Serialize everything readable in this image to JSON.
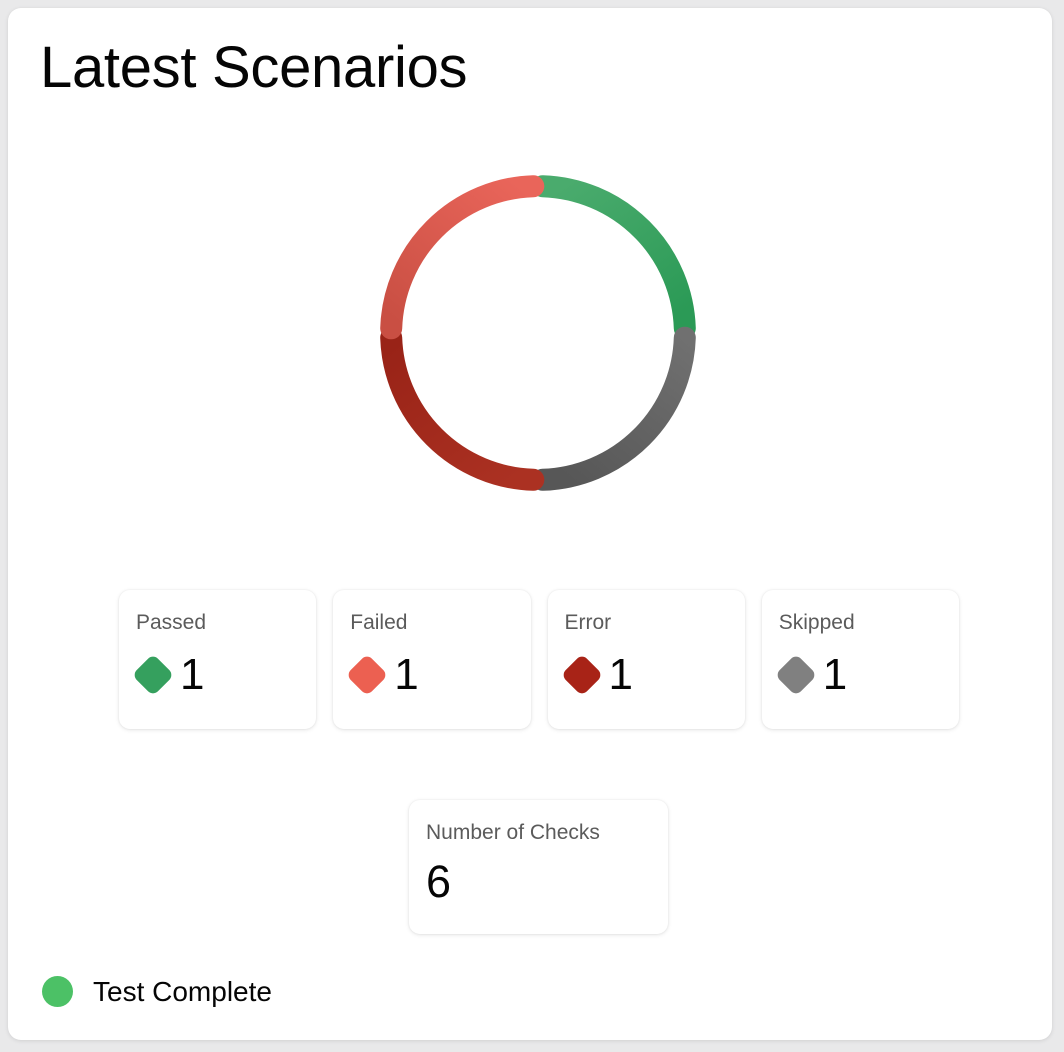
{
  "panel": {
    "title": "Latest Scenarios",
    "background_color": "#ffffff",
    "page_background_color": "#e9e9ea"
  },
  "chart_data": {
    "type": "pie",
    "variant": "donut",
    "title": "Latest Scenarios",
    "legend": "none",
    "grid": false,
    "total": 4,
    "gap_degrees": 6,
    "stroke_width_px": 22,
    "outer_radius_px": 158,
    "categories": [
      "Passed",
      "Failed",
      "Error",
      "Skipped"
    ],
    "values": [
      1,
      1,
      1,
      1
    ],
    "percentages": [
      25,
      25,
      25,
      25
    ],
    "colors": [
      "#35a05e",
      "#e05a4c",
      "#a22a1c",
      "#5e5e5e"
    ],
    "segments": [
      {
        "label": "Passed",
        "value": 1,
        "percent": 25,
        "color": "#35a05e",
        "start_deg": 0,
        "end_deg": 90,
        "position": "top-right"
      },
      {
        "label": "Skipped",
        "value": 1,
        "percent": 25,
        "color": "#5e5e5e",
        "start_deg": 90,
        "end_deg": 180,
        "position": "bottom-right"
      },
      {
        "label": "Error",
        "value": 1,
        "percent": 25,
        "color": "#a22a1c",
        "start_deg": 180,
        "end_deg": 270,
        "position": "bottom-left"
      },
      {
        "label": "Failed",
        "value": 1,
        "percent": 25,
        "color": "#e05a4c",
        "start_deg": 270,
        "end_deg": 360,
        "position": "top-left"
      }
    ]
  },
  "stats": [
    {
      "label": "Passed",
      "value": "1",
      "color": "#35a05e"
    },
    {
      "label": "Failed",
      "value": "1",
      "color": "#ec6051"
    },
    {
      "label": "Error",
      "value": "1",
      "color": "#a82317"
    },
    {
      "label": "Skipped",
      "value": "1",
      "color": "#808080"
    }
  ],
  "checks": {
    "label": "Number of Checks",
    "value": "6"
  },
  "status": {
    "text": "Test Complete",
    "color": "#4cc166",
    "icon": "status-dot-icon"
  }
}
